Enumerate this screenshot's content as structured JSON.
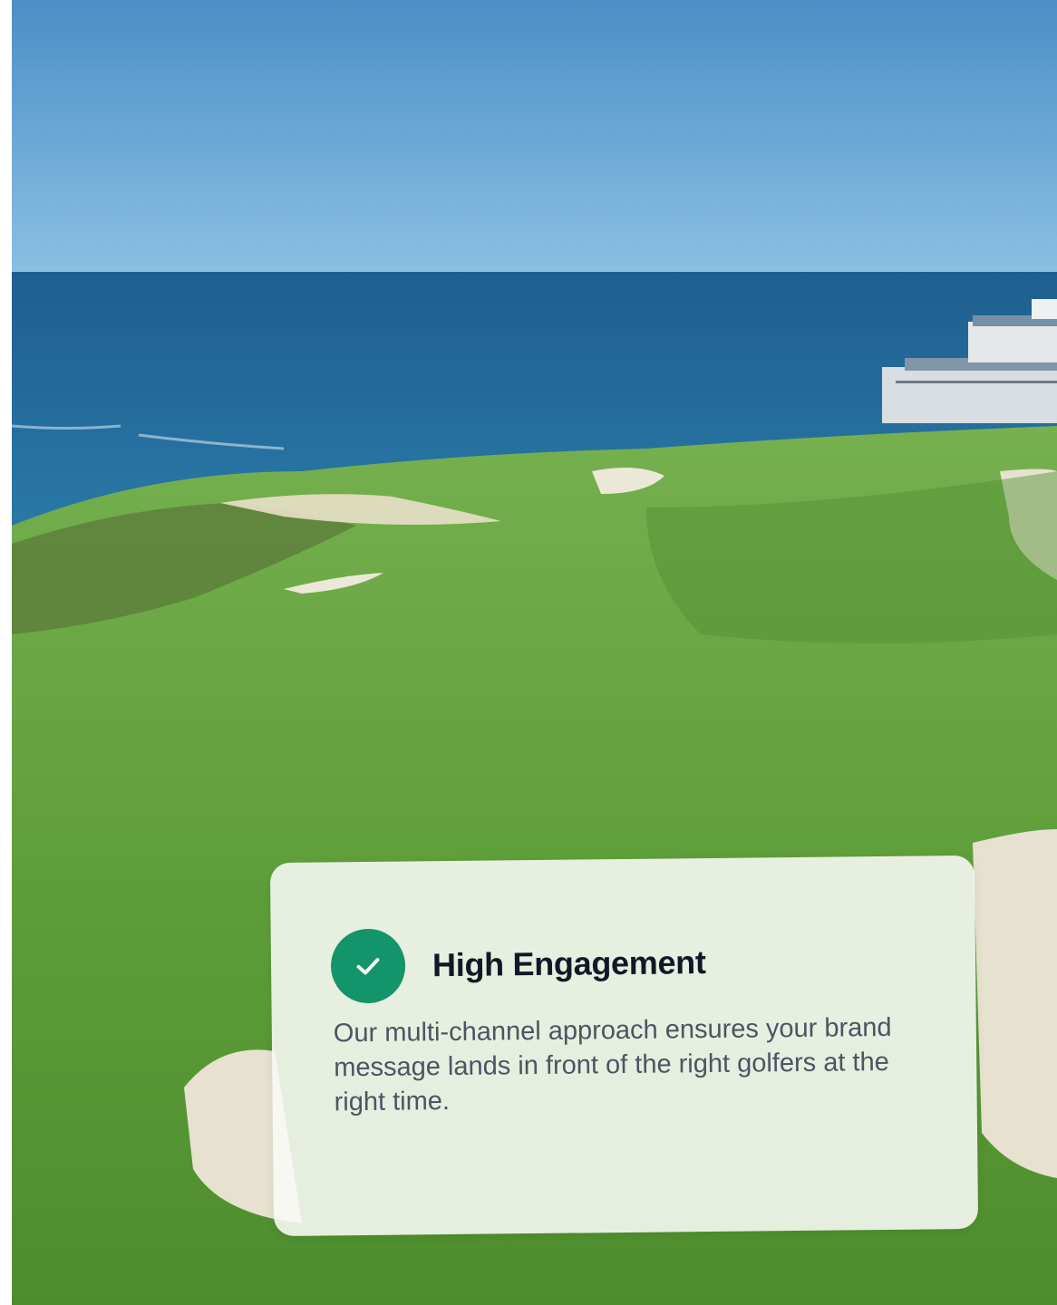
{
  "hero_image": {
    "alt_subject": "coastal golf course with clubhouse and ocean",
    "colors": {
      "sky_top": "#4b8fc6",
      "sky_bottom": "#8cc0e4",
      "ocean": "#1f6a9c",
      "grass": "#5fa33c",
      "sand": "#e6e2cf"
    }
  },
  "feature_card": {
    "icon": "check-icon",
    "accent_color": "#13946a",
    "title": "High Engagement",
    "description": "Our multi-channel approach ensures your brand message lands in front of the right golfers at the right time."
  }
}
